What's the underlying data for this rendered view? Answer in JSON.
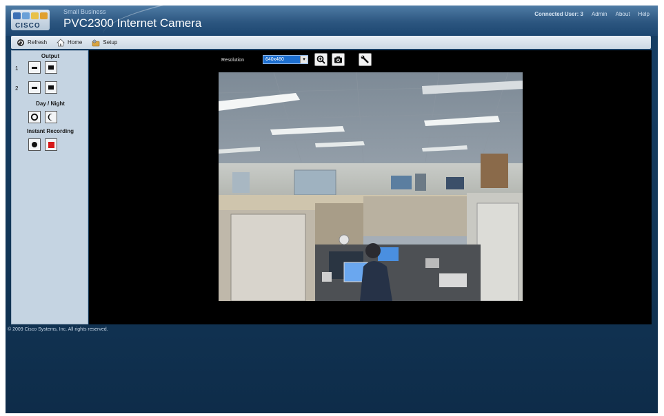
{
  "header": {
    "logo_text": "CISCO",
    "brand": "Small Business",
    "product_title": "PVC2300 Internet Camera",
    "connected_user": "Connected User: 3",
    "links": [
      "Admin",
      "About",
      "Help"
    ]
  },
  "toolbar": {
    "items": [
      {
        "label": "Refresh",
        "icon": "refresh-icon"
      },
      {
        "label": "Home",
        "icon": "home-icon"
      },
      {
        "label": "Setup",
        "icon": "setup-icon"
      }
    ]
  },
  "left_panel": {
    "output_title": "Output",
    "output_rows": [
      "1",
      "2"
    ],
    "daynight_title": "Day / Night",
    "recording_title": "Instant Recording"
  },
  "video": {
    "resolution_label": "Resolution",
    "resolution_value": "640x480"
  },
  "footer": {
    "copyright": "© 2009 Cisco Systems, Inc. All rights reserved."
  },
  "colors": {
    "header_blue": "#2c5680",
    "panel_bg": "#c5d4e2",
    "video_bg": "#000000",
    "page_bg": "#123657",
    "record_red": "#d61a1a"
  }
}
